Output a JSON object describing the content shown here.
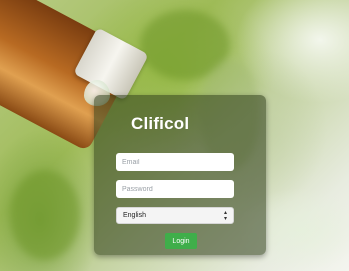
{
  "app": {
    "brand": "Clificol"
  },
  "form": {
    "email_placeholder": "Email",
    "password_placeholder": "Password",
    "language_selected": "English",
    "login_label": "Login"
  },
  "icons": {
    "select": "chevron-updown-icon"
  },
  "colors": {
    "login_button": "#3fae4a",
    "panel": "#2d3c19"
  }
}
